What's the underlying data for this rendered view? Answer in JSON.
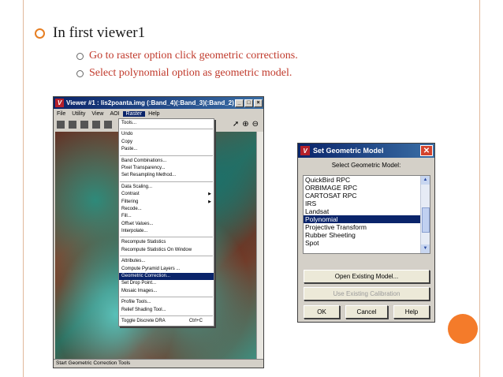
{
  "slide": {
    "bullet1": "In first viewer1",
    "sub_bullets": [
      "Go to raster option click geometric corrections.",
      "Select polynomial option as geometric model."
    ]
  },
  "viewer": {
    "title": "Viewer #1 : lis2poanta.img (:Band_4)(:Band_3)(:Band_2)",
    "menus": [
      "File",
      "Utility",
      "View",
      "AOI",
      "Raster",
      "Help"
    ],
    "active_menu": "Raster",
    "status_text": "Start Geometric Correction Tools"
  },
  "raster_menu": {
    "groups": [
      [
        "Tools..."
      ],
      [
        "Undo",
        "Copy",
        "Paste..."
      ],
      [
        "Band Combinations...",
        "Pixel Transparency...",
        "Set Resampling Method..."
      ],
      [
        "Data Scaling...",
        "Contrast",
        "Filtering",
        "Recode...",
        "Fill...",
        "Offset Values...",
        "Interpolate..."
      ],
      [
        "Recompute Statistics",
        "Recompute Statistics On Window"
      ],
      [
        "Attributes...",
        "Compute Pyramid Layers ...",
        "Geometric Correction...",
        "Set Drop Point...",
        "Mosaic Images..."
      ],
      [
        "Profile Tools...",
        "Relief Shading Tool..."
      ],
      [
        "Toggle Discrete DRA"
      ]
    ],
    "submenu_items": [
      "Contrast",
      "Filtering"
    ],
    "selected": "Geometric Correction...",
    "shortcut": "Ctrl+C"
  },
  "dialog": {
    "title": "Set Geometric Model",
    "subtitle": "Select Geometric Model:",
    "models": [
      "QuickBird RPC",
      "ORBIMAGE RPC",
      "CARTOSAT RPC",
      "IRS",
      "Landsat",
      "Polynomial",
      "Projective Transform",
      "Rubber Sheeting",
      "Spot"
    ],
    "selected_model": "Polynomial",
    "open_existing": "Open Existing Model...",
    "use_existing": "Use Existing Calibration",
    "ok": "OK",
    "cancel": "Cancel",
    "help": "Help"
  },
  "colors": {
    "accent_orange": "#f47b2a",
    "bullet_red": "#c0392b",
    "title_bar": "#0a246a"
  }
}
